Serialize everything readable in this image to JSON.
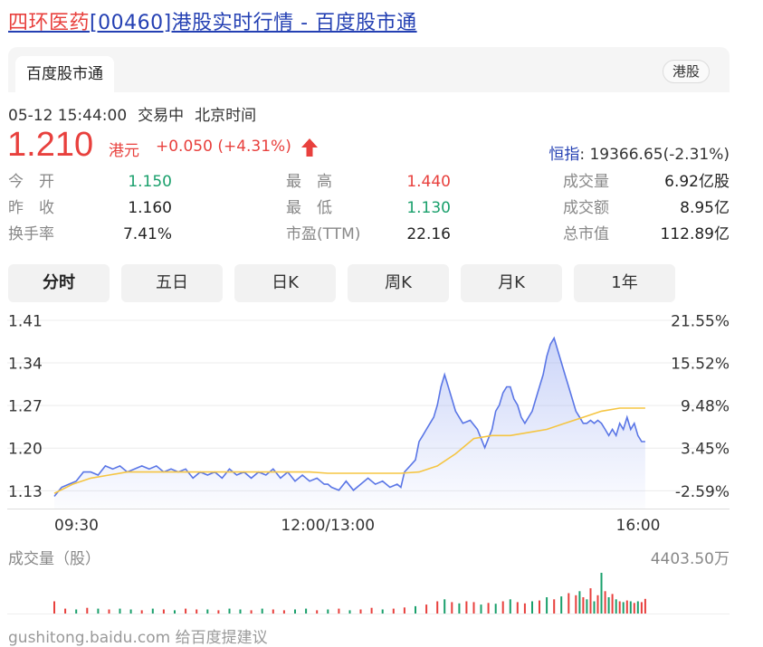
{
  "page": {
    "title_stock": "四环医药",
    "title_rest": "[00460]港股实时行情 - 百度股市通",
    "tab": "百度股市通",
    "badge": "港股"
  },
  "quote": {
    "datetime": "05-12 15:44:00",
    "status": "交易中",
    "timezone": "北京时间",
    "price": "1.210",
    "unit": "港元",
    "change": "+0.050 (+4.31%)",
    "index_name": "恒指",
    "index_value": ": 19366.65(-2.31%)"
  },
  "stats": [
    {
      "label": "今　开",
      "value": "1.150"
    },
    {
      "label": "最　高",
      "value": "1.440"
    },
    {
      "label": "成交量",
      "value": "6.92亿股"
    },
    {
      "label": "昨　收",
      "value": "1.160"
    },
    {
      "label": "最　低",
      "value": "1.130"
    },
    {
      "label": "成交额",
      "value": "8.95亿"
    },
    {
      "label": "换手率",
      "value": "7.41%"
    },
    {
      "label": "市盈(TTM)",
      "value": "22.16"
    },
    {
      "label": "总市值",
      "value": "112.89亿"
    }
  ],
  "period_tabs": [
    "分时",
    "五日",
    "日K",
    "周K",
    "月K",
    "1年"
  ],
  "colors": {
    "up": "#e8403d",
    "down": "#1aa06c",
    "price_line": "#5a76e6",
    "avg_line": "#f5c542",
    "link": "#2440b3"
  },
  "chart_data": {
    "type": "line",
    "ylim": [
      1.1,
      1.43
    ],
    "y_ticks": [
      "1.41",
      "1.34",
      "1.27",
      "1.20",
      "1.13"
    ],
    "y_tick_values": [
      1.41,
      1.34,
      1.27,
      1.2,
      1.13
    ],
    "pct_ticks": [
      "21.55%",
      "15.52%",
      "9.48%",
      "3.45%",
      "-2.59%"
    ],
    "x_labels": [
      "09:30",
      "12:00/13:00",
      "16:00"
    ],
    "x_range_minutes": [
      0,
      330
    ],
    "series": [
      {
        "x": [
          0,
          4,
          8,
          12,
          16,
          20,
          24,
          28,
          32,
          36,
          40,
          44,
          48,
          52,
          56,
          60,
          64,
          68,
          72,
          76,
          80,
          84,
          88,
          92,
          96,
          100,
          104,
          108,
          112,
          116,
          120,
          124,
          128,
          132,
          136,
          140,
          144,
          148,
          150,
          152,
          156,
          160,
          164,
          168,
          172,
          176,
          180,
          184,
          188,
          190,
          192,
          195,
          198,
          200,
          202,
          204,
          206,
          208,
          210,
          212,
          214,
          216,
          218,
          220,
          224,
          228,
          232,
          236,
          240,
          242,
          244,
          246,
          248,
          250,
          252,
          254,
          256,
          258,
          260,
          262,
          264,
          266,
          268,
          270,
          272,
          274,
          276,
          278,
          280,
          282,
          284,
          286,
          288,
          290,
          292,
          294,
          296,
          298,
          300,
          302,
          304,
          306,
          308,
          310,
          312,
          314,
          316,
          318,
          320,
          322,
          324
        ],
        "values": [
          1.12,
          1.135,
          1.14,
          1.145,
          1.16,
          1.16,
          1.155,
          1.17,
          1.165,
          1.17,
          1.16,
          1.165,
          1.17,
          1.165,
          1.17,
          1.16,
          1.165,
          1.16,
          1.165,
          1.15,
          1.16,
          1.155,
          1.16,
          1.15,
          1.165,
          1.155,
          1.16,
          1.15,
          1.16,
          1.155,
          1.165,
          1.15,
          1.16,
          1.145,
          1.155,
          1.145,
          1.15,
          1.14,
          1.14,
          1.135,
          1.13,
          1.145,
          1.13,
          1.14,
          1.15,
          1.14,
          1.145,
          1.135,
          1.14,
          1.135,
          1.16,
          1.17,
          1.18,
          1.21,
          1.22,
          1.23,
          1.24,
          1.25,
          1.27,
          1.3,
          1.32,
          1.3,
          1.28,
          1.26,
          1.24,
          1.245,
          1.23,
          1.2,
          1.23,
          1.26,
          1.27,
          1.29,
          1.3,
          1.3,
          1.28,
          1.27,
          1.25,
          1.24,
          1.25,
          1.26,
          1.28,
          1.3,
          1.32,
          1.35,
          1.37,
          1.38,
          1.36,
          1.34,
          1.32,
          1.3,
          1.28,
          1.26,
          1.25,
          1.24,
          1.24,
          1.245,
          1.24,
          1.245,
          1.24,
          1.23,
          1.22,
          1.23,
          1.22,
          1.24,
          1.23,
          1.25,
          1.23,
          1.24,
          1.22,
          1.21,
          1.21
        ]
      },
      {
        "x": [
          0,
          10,
          20,
          30,
          40,
          50,
          60,
          70,
          80,
          90,
          100,
          110,
          120,
          130,
          140,
          150,
          160,
          170,
          180,
          190,
          200,
          210,
          220,
          230,
          240,
          250,
          260,
          270,
          280,
          290,
          300,
          310,
          320,
          324
        ],
        "values": [
          1.125,
          1.14,
          1.15,
          1.155,
          1.16,
          1.16,
          1.16,
          1.16,
          1.16,
          1.16,
          1.16,
          1.16,
          1.16,
          1.16,
          1.16,
          1.158,
          1.158,
          1.158,
          1.158,
          1.158,
          1.16,
          1.17,
          1.19,
          1.215,
          1.22,
          1.22,
          1.225,
          1.23,
          1.24,
          1.25,
          1.26,
          1.265,
          1.265,
          1.265
        ]
      }
    ],
    "volume": {
      "label": "成交量（股）",
      "max_label": "4403.50万",
      "x": [
        0,
        6,
        12,
        18,
        24,
        30,
        36,
        42,
        48,
        54,
        60,
        66,
        72,
        78,
        84,
        90,
        96,
        102,
        108,
        114,
        120,
        126,
        132,
        138,
        144,
        150,
        156,
        162,
        168,
        174,
        180,
        186,
        192,
        198,
        204,
        210,
        214,
        218,
        222,
        226,
        230,
        234,
        238,
        242,
        246,
        250,
        254,
        258,
        262,
        266,
        270,
        274,
        278,
        282,
        286,
        288,
        290,
        292,
        294,
        296,
        298,
        300,
        302,
        304,
        306,
        308,
        310,
        312,
        314,
        316,
        318,
        320,
        322,
        324
      ],
      "values": [
        0.3,
        0.12,
        0.1,
        0.14,
        0.12,
        0.1,
        0.12,
        0.1,
        0.08,
        0.12,
        0.1,
        0.08,
        0.12,
        0.1,
        0.1,
        0.08,
        0.12,
        0.1,
        0.08,
        0.12,
        0.1,
        0.08,
        0.1,
        0.12,
        0.08,
        0.1,
        0.12,
        0.08,
        0.1,
        0.14,
        0.1,
        0.12,
        0.15,
        0.18,
        0.22,
        0.3,
        0.35,
        0.28,
        0.25,
        0.3,
        0.28,
        0.22,
        0.26,
        0.24,
        0.3,
        0.35,
        0.28,
        0.25,
        0.3,
        0.32,
        0.4,
        0.35,
        0.42,
        0.5,
        0.45,
        0.55,
        0.4,
        0.35,
        0.62,
        0.3,
        0.45,
        1.0,
        0.55,
        0.4,
        0.48,
        0.35,
        0.3,
        0.28,
        0.32,
        0.3,
        0.26,
        0.3,
        0.28,
        0.36
      ],
      "up": [
        1,
        1,
        0,
        1,
        0,
        1,
        0,
        0,
        1,
        0,
        1,
        0,
        1,
        1,
        0,
        1,
        0,
        0,
        1,
        0,
        1,
        1,
        0,
        0,
        1,
        0,
        1,
        0,
        1,
        1,
        0,
        1,
        1,
        0,
        1,
        1,
        0,
        1,
        0,
        1,
        1,
        0,
        1,
        0,
        1,
        0,
        1,
        1,
        0,
        1,
        0,
        1,
        0,
        1,
        1,
        0,
        1,
        0,
        1,
        0,
        1,
        0,
        1,
        0,
        1,
        0,
        1,
        0,
        1,
        0,
        1,
        0,
        1,
        1
      ]
    }
  },
  "footer": "gushitong.baidu.com  给百度提建议"
}
